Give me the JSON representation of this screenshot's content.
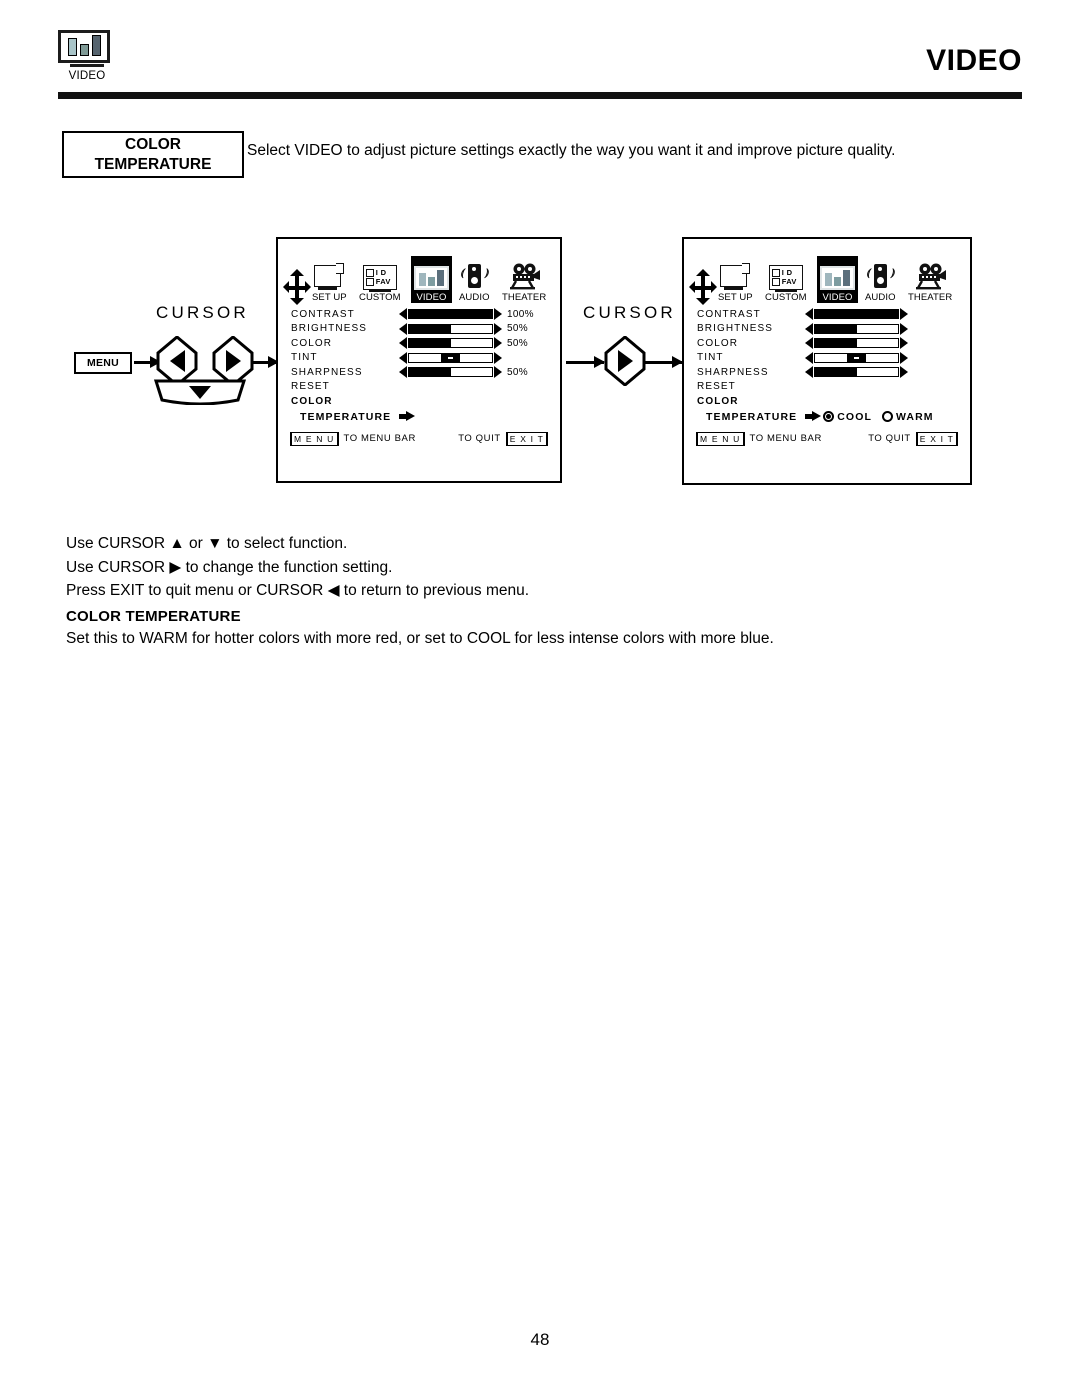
{
  "header": {
    "icon_name": "video-tv-icon",
    "icon_label": "VIDEO",
    "title": "VIDEO",
    "icon_bars": [
      {
        "color": "#a8c4c8",
        "width": 9,
        "height": 18
      },
      {
        "color": "#7f9a96",
        "width": 9,
        "height": 12
      },
      {
        "color": "#55636e",
        "width": 9,
        "height": 21
      }
    ]
  },
  "label_box": {
    "line1": "COLOR",
    "line2": "TEMPERATURE"
  },
  "description": "Select VIDEO to adjust picture settings exactly the way you want it and improve picture quality.",
  "diagram": {
    "cursor_label_left": "CURSOR",
    "cursor_label_middle": "CURSOR",
    "menu_button": "MENU",
    "buttons": [
      {
        "name": "cursor-left-button",
        "glyph": "left-triangle"
      },
      {
        "name": "cursor-right-button",
        "glyph": "right-triangle"
      },
      {
        "name": "cursor-down-button",
        "glyph": "down-triangle"
      },
      {
        "name": "cursor-right-button-middle",
        "glyph": "right-triangle"
      }
    ]
  },
  "osd_menu_icons": [
    {
      "name": "cursor-4way-icon",
      "label": "",
      "selected": false
    },
    {
      "name": "setup-icon",
      "label": "SET UP",
      "selected": false
    },
    {
      "name": "custom-icon",
      "label": "CUSTOM",
      "selected": false,
      "check1": "I D",
      "check2": "FAV"
    },
    {
      "name": "video-icon",
      "label": "VIDEO",
      "selected": true
    },
    {
      "name": "audio-speaker-icon",
      "label": "AUDIO",
      "selected": false
    },
    {
      "name": "theater-projector-icon",
      "label": "THEATER",
      "selected": false
    }
  ],
  "panel_left": {
    "rows": [
      {
        "name": "CONTRAST",
        "type": "bar",
        "fill": 100,
        "value": "100%"
      },
      {
        "name": "BRIGHTNESS",
        "type": "bar",
        "fill": 50,
        "value": "50%"
      },
      {
        "name": "COLOR",
        "type": "bar",
        "fill": 50,
        "value": "50%"
      },
      {
        "name": "TINT",
        "type": "center",
        "fill": 50,
        "value": ""
      },
      {
        "name": "SHARPNESS",
        "type": "bar",
        "fill": 50,
        "value": "50%"
      },
      {
        "name": "RESET",
        "type": "none",
        "fill": 0,
        "value": ""
      },
      {
        "name": "COLOR",
        "type": "none",
        "fill": 0,
        "value": "",
        "bold": true
      }
    ],
    "temperature_label": "TEMPERATURE",
    "options_shown": false,
    "footer": {
      "menu_key": "M E N U",
      "menu_text": "TO MENU BAR",
      "quit_text": "TO QUIT",
      "exit_key": "E X I T"
    }
  },
  "panel_right": {
    "rows": [
      {
        "name": "CONTRAST",
        "type": "bar",
        "fill": 100,
        "value": ""
      },
      {
        "name": "BRIGHTNESS",
        "type": "bar",
        "fill": 50,
        "value": ""
      },
      {
        "name": "COLOR",
        "type": "bar",
        "fill": 50,
        "value": ""
      },
      {
        "name": "TINT",
        "type": "center",
        "fill": 50,
        "value": ""
      },
      {
        "name": "SHARPNESS",
        "type": "bar",
        "fill": 50,
        "value": ""
      },
      {
        "name": "RESET",
        "type": "none",
        "fill": 0,
        "value": ""
      },
      {
        "name": "COLOR",
        "type": "none",
        "fill": 0,
        "value": "",
        "bold": true
      }
    ],
    "temperature_label": "TEMPERATURE",
    "options_shown": true,
    "option_cool": "COOL",
    "option_warm": "WARM",
    "selected_option": "COOL",
    "footer": {
      "menu_key": "M E N U",
      "menu_text": "TO MENU BAR",
      "quit_text": "TO QUIT",
      "exit_key": "E X I T"
    }
  },
  "instructions": [
    "Use CURSOR ▲ or ▼ to select function.",
    "Use CURSOR ▶ to change the function setting.",
    "Press EXIT to quit menu or CURSOR ◀ to return to previous menu."
  ],
  "section": {
    "heading": "COLOR TEMPERATURE",
    "body": "Set this to WARM for hotter colors with more red, or set to COOL for less intense colors with more blue."
  },
  "page_number": "48"
}
